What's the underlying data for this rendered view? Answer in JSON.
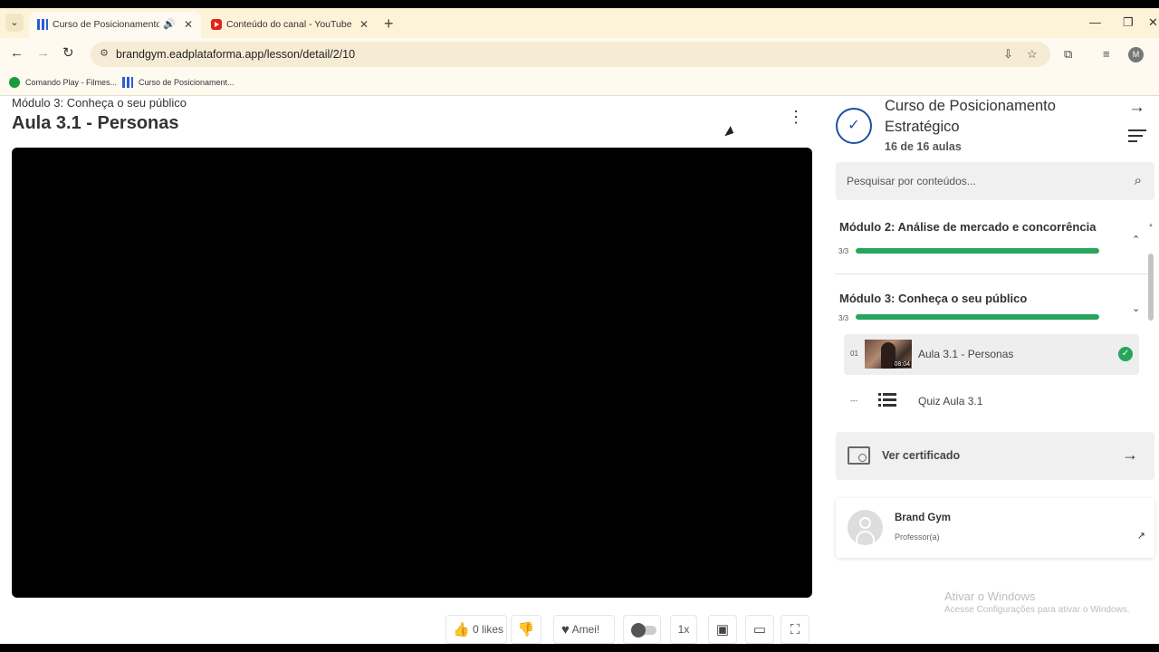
{
  "browser": {
    "tabs": [
      {
        "title": "Curso de Posicionamento Estratégico",
        "active": true,
        "audio_icon": "speaker-icon"
      },
      {
        "title": "Conteúdo do canal - YouTube Studio",
        "active": false
      }
    ],
    "url": "brandgym.eadplataforma.app/lesson/detail/2/10",
    "profile_initial": "M",
    "bookmarks": [
      {
        "label": "Comando Play - Filmes..."
      },
      {
        "label": "Curso de Posicionament..."
      }
    ]
  },
  "lesson": {
    "module_label": "Módulo 3: Conheça o seu público",
    "title": "Aula 3.1 - Personas"
  },
  "controls": {
    "likes_label": "0 likes",
    "love_label": "Amei!",
    "speed_label": "1x"
  },
  "course": {
    "title": "Curso de Posicionamento Estratégico",
    "count_label": "16 de 16 aulas",
    "search_placeholder": "Pesquisar por conteúdos...",
    "modules": [
      {
        "title": "Módulo 2: Análise de mercado e concorrência",
        "count": "3/3",
        "progress": 1.0,
        "expanded": false
      },
      {
        "title": "Módulo 3: Conheça o seu público",
        "count": "3/3",
        "progress": 1.0,
        "expanded": true,
        "lessons": [
          {
            "num": "01",
            "title": "Aula 3.1 - Personas",
            "duration": "08:04",
            "completed": true,
            "active": true
          },
          {
            "num": "---",
            "title": "Quiz Aula 3.1",
            "completed": false,
            "active": false
          }
        ]
      }
    ],
    "certificate_label": "Ver certificado",
    "teacher": {
      "name": "Brand Gym",
      "role": "Professor(a)"
    }
  },
  "watermark": {
    "line1": "Ativar o Windows",
    "line2": "Acesse Configurações para ativar o Windows."
  },
  "colors": {
    "accent_green": "#27a55b",
    "accent_blue": "#1f4fa3"
  }
}
